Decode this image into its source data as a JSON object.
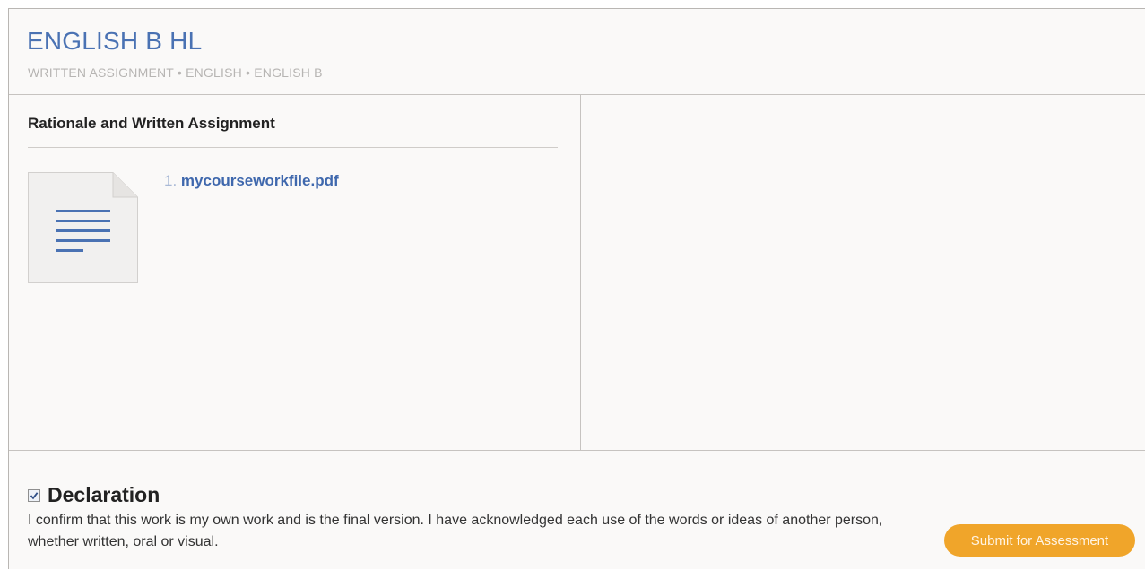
{
  "header": {
    "title": "ENGLISH B HL",
    "breadcrumb": "WRITTEN ASSIGNMENT • ENGLISH • ENGLISH B"
  },
  "left_panel": {
    "section_title": "Rationale and Written Assignment",
    "files": [
      {
        "number": "1.",
        "name": "mycourseworkfile.pdf",
        "icon": "document-icon"
      }
    ]
  },
  "declaration": {
    "checked": true,
    "title": "Declaration",
    "text": "I confirm that this work is my own work and is the final version. I have acknowledged each use of the words or ideas of another person, whether written, oral or visual.",
    "submit_label": "Submit for Assessment"
  },
  "colors": {
    "title": "#4a72b3",
    "link": "#3f68ad",
    "button": "#f0a52a",
    "background": "#faf9f8"
  }
}
